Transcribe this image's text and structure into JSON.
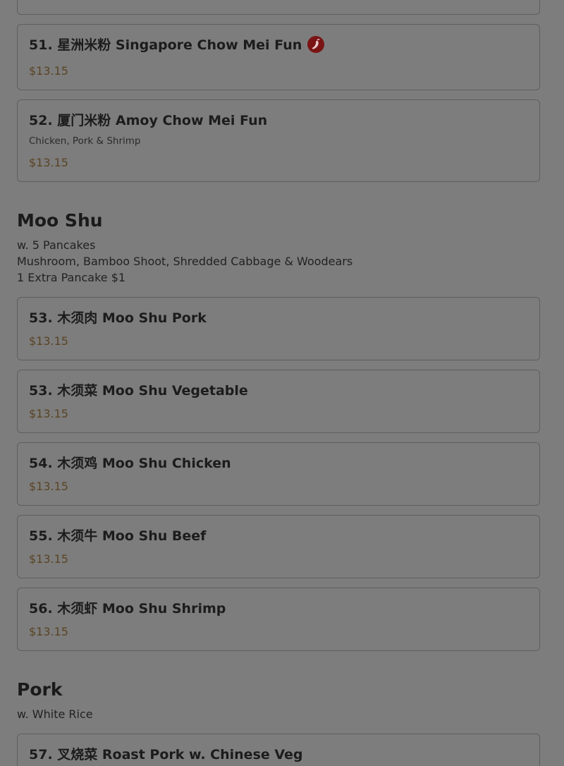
{
  "sections": {
    "noodles_tail": {
      "items": [
        {
          "title": "51. 星洲米粉 Singapore Chow Mei Fun",
          "price": "$13.15",
          "icon": "spicy-pepper-icon"
        },
        {
          "title": "52. 厦门米粉 Amoy Chow Mei Fun",
          "description": "Chicken, Pork & Shrimp",
          "price": "$13.15"
        }
      ]
    },
    "moo_shu": {
      "title": "Moo Shu",
      "notes": [
        "w. 5 Pancakes",
        "Mushroom, Bamboo Shoot, Shredded Cabbage & Woodears",
        "1 Extra Pancake $1"
      ],
      "items": [
        {
          "title": "53. 木须肉 Moo Shu Pork",
          "price": "$13.15"
        },
        {
          "title": "53. 木须菜 Moo Shu Vegetable",
          "price": "$13.15"
        },
        {
          "title": "54. 木须鸡 Moo Shu Chicken",
          "price": "$13.15"
        },
        {
          "title": "55. 木须牛 Moo Shu Beef",
          "price": "$13.15"
        },
        {
          "title": "56. 木须虾 Moo Shu Shrimp",
          "price": "$13.15"
        }
      ]
    },
    "pork": {
      "title": "Pork",
      "notes": [
        "w. White Rice"
      ],
      "items": [
        {
          "title": "57. 叉烧菜 Roast Pork w. Chinese Veg"
        }
      ]
    }
  },
  "colors": {
    "overlay_background": "#7d7d7d",
    "price_text": "#5a4424",
    "spicy_badge": "#7a1414"
  }
}
